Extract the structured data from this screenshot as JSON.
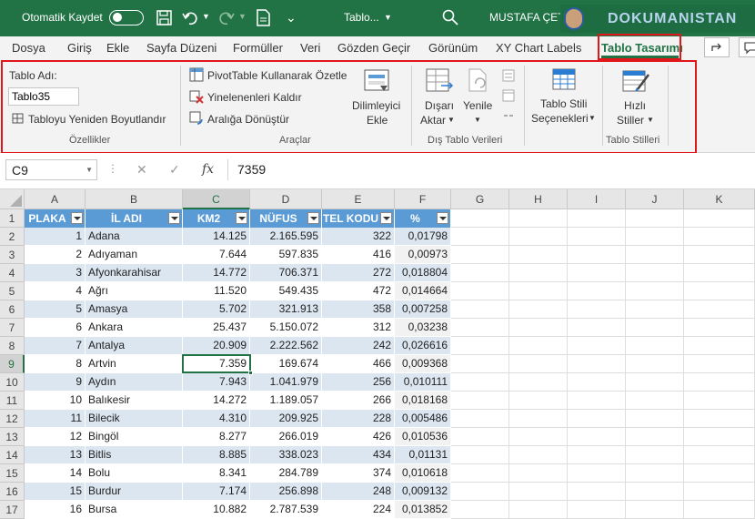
{
  "titlebar": {
    "autosave_label": "Otomatik Kaydet",
    "filename": "Tablo...",
    "user_name": "MUSTAFA ÇET",
    "watermark": "DOKUMANISTAN"
  },
  "tabs": [
    "Dosya",
    "Giriş",
    "Ekle",
    "Sayfa Düzeni",
    "Formüller",
    "Veri",
    "Gözden Geçir",
    "Görünüm",
    "XY Chart Labels",
    "Tablo Tasarımı"
  ],
  "ribbon": {
    "properties": {
      "name_label": "Tablo Adı:",
      "name_value": "Tablo35",
      "resize_label": "Tabloyu Yeniden Boyutlandır",
      "group_label": "Özellikler"
    },
    "tools": {
      "pivot_label": "PivotTable Kullanarak Özetle",
      "dupes_label": "Yinelenenleri Kaldır",
      "convert_label": "Aralığa Dönüştür",
      "slicer_label1": "Dilimleyici",
      "slicer_label2": "Ekle",
      "group_label": "Araçlar"
    },
    "external": {
      "export_label1": "Dışarı",
      "export_label2": "Aktar",
      "refresh_label": "Yenile",
      "group_label": "Dış Tablo Verileri"
    },
    "style_options": {
      "label1": "Tablo Stili",
      "label2": "Seçenekleri"
    },
    "styles": {
      "label1": "Hızlı",
      "label2": "Stiller",
      "group_label": "Tablo Stilleri"
    }
  },
  "formula_bar": {
    "name_box": "C9",
    "value": "7359",
    "fx": "fx"
  },
  "columns": [
    "A",
    "B",
    "C",
    "D",
    "E",
    "F",
    "G",
    "H",
    "I",
    "J",
    "K"
  ],
  "table": {
    "headers": [
      "PLAKA",
      "İL ADI",
      "KM2",
      "NÜFUS",
      "TEL KODU",
      "%"
    ],
    "rows": [
      [
        "1",
        "Adana",
        "14.125",
        "2.165.595",
        "322",
        "0,01798"
      ],
      [
        "2",
        "Adıyaman",
        "7.644",
        "597.835",
        "416",
        "0,00973"
      ],
      [
        "3",
        "Afyonkarahisar",
        "14.772",
        "706.371",
        "272",
        "0,018804"
      ],
      [
        "4",
        "Ağrı",
        "11.520",
        "549.435",
        "472",
        "0,014664"
      ],
      [
        "5",
        "Amasya",
        "5.702",
        "321.913",
        "358",
        "0,007258"
      ],
      [
        "6",
        "Ankara",
        "25.437",
        "5.150.072",
        "312",
        "0,03238"
      ],
      [
        "7",
        "Antalya",
        "20.909",
        "2.222.562",
        "242",
        "0,026616"
      ],
      [
        "8",
        "Artvin",
        "7.359",
        "169.674",
        "466",
        "0,009368"
      ],
      [
        "9",
        "Aydın",
        "7.943",
        "1.041.979",
        "256",
        "0,010111"
      ],
      [
        "10",
        "Balıkesir",
        "14.272",
        "1.189.057",
        "266",
        "0,018168"
      ],
      [
        "11",
        "Bilecik",
        "4.310",
        "209.925",
        "228",
        "0,005486"
      ],
      [
        "12",
        "Bingöl",
        "8.277",
        "266.019",
        "426",
        "0,010536"
      ],
      [
        "13",
        "Bitlis",
        "8.885",
        "338.023",
        "434",
        "0,01131"
      ],
      [
        "14",
        "Bolu",
        "8.341",
        "284.789",
        "374",
        "0,010618"
      ],
      [
        "15",
        "Burdur",
        "7.174",
        "256.898",
        "248",
        "0,009132"
      ],
      [
        "16",
        "Bursa",
        "10.882",
        "2.787.539",
        "224",
        "0,013852"
      ]
    ]
  },
  "colors": {
    "titlebar": "#217346",
    "table_header": "#5b9bd5",
    "band": "#dce6f1",
    "highlight": "#e0161b",
    "active_tab": "#217346"
  }
}
